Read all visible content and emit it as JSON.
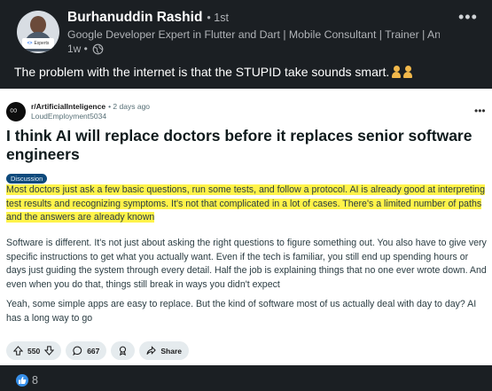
{
  "author": {
    "name": "Burhanuddin Rashid",
    "degree": "• 1st",
    "headline": "Google Developer Expert in Flutter and Dart | Mobile Consultant | Trainer | An...",
    "time": "1w •",
    "avatar_tag": "Experts"
  },
  "post": {
    "text": "The problem with the internet is that the STUPID take sounds smart."
  },
  "reddit": {
    "subreddit": "r/ArtificialInteligence",
    "time": "• 2 days ago",
    "username": "LoudEmployment5034",
    "title": "I think AI will replace doctors before it replaces senior software engineers",
    "flair": "Discussion",
    "para1": "Most doctors just ask a few basic questions, run some tests, and follow a protocol. AI is already good at interpreting test results and recognizing symptoms. It's not that complicated in a lot of cases. There's a limited number of paths and the answers are already known",
    "para2": "Software is different. It's not just about asking the right questions to figure something out. You also have to give very specific instructions to get what you actually want. Even if the tech is familiar, you still end up spending hours or days just guiding the system through every detail. Half the job is explaining things that no one ever wrote down. And even when you do that, things still break in ways you didn't expect",
    "para3": "Yeah, some simple apps are easy to replace. But the kind of software most of us actually deal with day to day? AI has a long way to go",
    "upvotes": "550",
    "comments": "667",
    "share_label": "Share"
  },
  "reactions": {
    "count": "8"
  },
  "icons": {
    "globe": "globe-icon",
    "more": "more-icon",
    "upvote": "upvote-icon",
    "downvote": "downvote-icon",
    "comment": "comment-icon",
    "award": "award-icon",
    "share": "share-icon",
    "like": "like-icon"
  },
  "colors": {
    "background": "#1b1f23",
    "highlight": "#fff34a",
    "flair": "#0e4a7c",
    "like": "#378fe9"
  }
}
